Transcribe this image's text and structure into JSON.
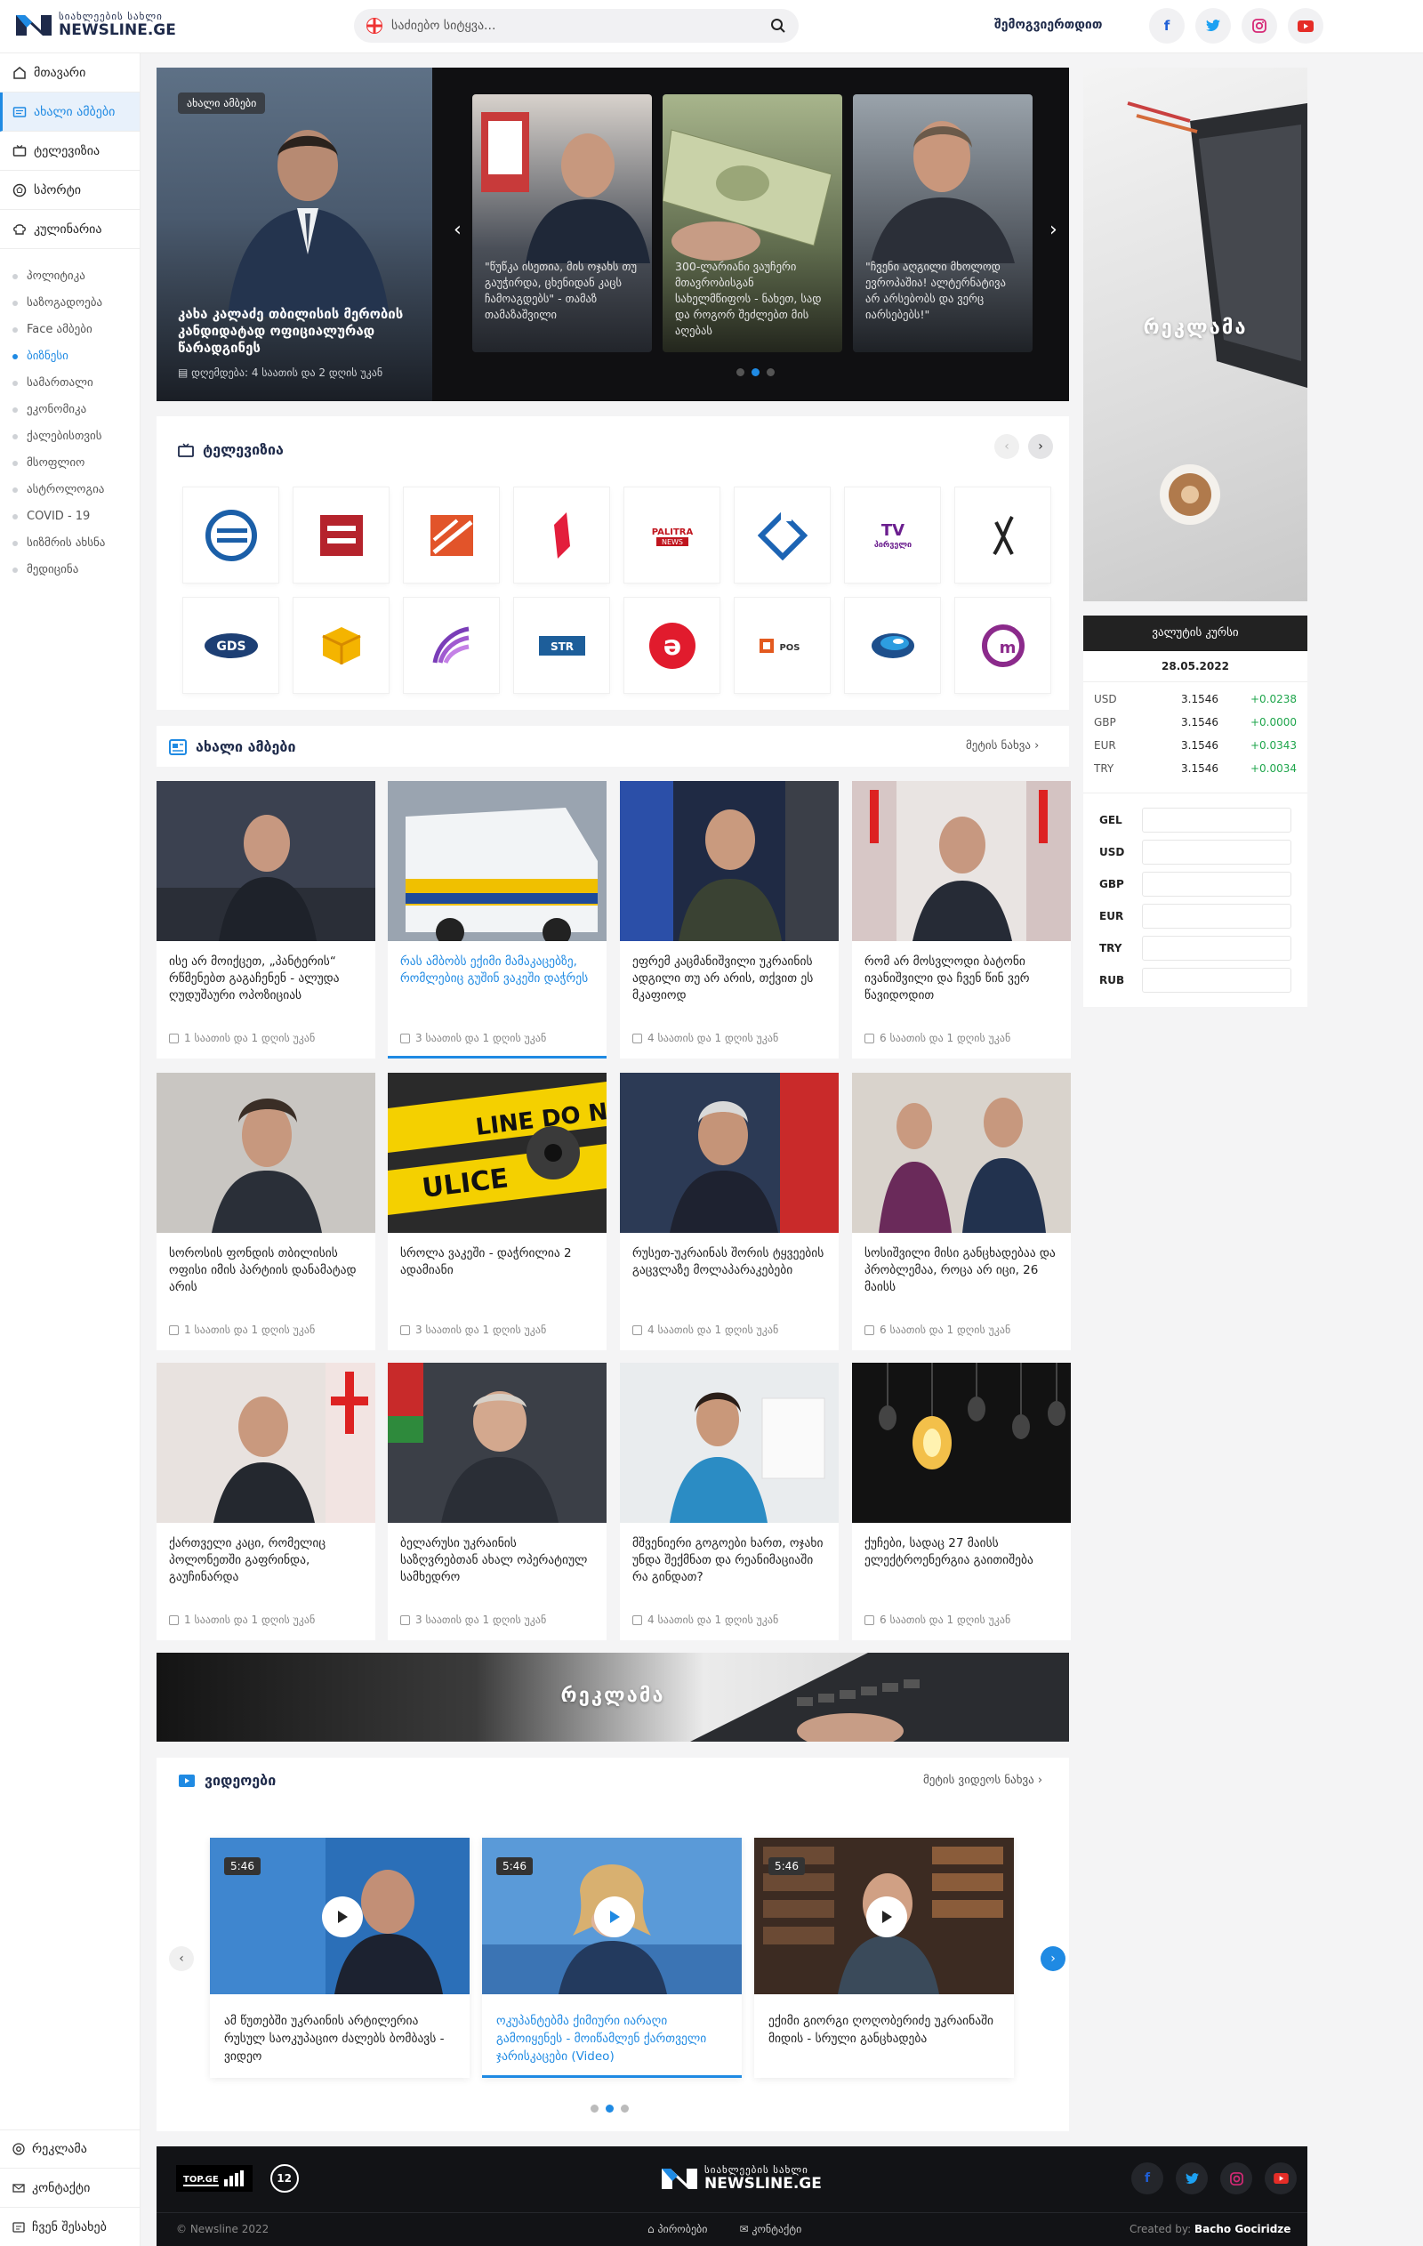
{
  "header": {
    "logo_top": "სიახლეების სახლი",
    "logo_bottom": "NEWSLINE.GE",
    "search_placeholder": "საძიებო სიტყვა...",
    "login": "შემოგვიერთდით"
  },
  "sidebar": {
    "items": [
      {
        "label": "მთავარი"
      },
      {
        "label": "ახალი ამბები"
      },
      {
        "label": "ტელევიზია"
      },
      {
        "label": "სპორტი"
      },
      {
        "label": "კულინარია"
      }
    ],
    "subs": [
      "პოლიტიკა",
      "საზოგადოება",
      "Face ამბები",
      "ბიზნესი",
      "სამართალი",
      "ეკონომიკა",
      "ქალებისთვის",
      "მსოფლიო",
      "ასტროლოგია",
      "COVID - 19",
      "სიზმრის ახსნა",
      "მედიცინა"
    ],
    "bottom": [
      {
        "label": "რეკლამა"
      },
      {
        "label": "კონტაქტი"
      },
      {
        "label": "ჩვენ შესახებ"
      }
    ]
  },
  "hero": {
    "tag": "ახალი ამბები",
    "title": "კახა კალაძე თბილისის მერობის კანდიდატად ოფიციალურად წარადგინეს",
    "time": "დღემდება: 4 საათის და 2 დღის უკან",
    "slides": [
      {
        "caption": "\"წუწკა ისეთია, მის ოჯახს თუ გაუჭირდა, ცხენიდან კაცს ჩამოაგდებს\" - თამაზ თამაზაშვილი"
      },
      {
        "caption": "300-ლარიანი ვაუჩერი მთავრობისგან სახელმწიფოს - ნახეთ, სად და როგორ შეძლებთ მის აღებას"
      },
      {
        "caption": "\"ჩვენი აღგილი მხოლოდ ევროპაშია! ალტერნატივა არ არსებობს და ვერც იარსებებს!\""
      }
    ]
  },
  "ads": {
    "side": "რეკლამა",
    "banner": "რეკლამა"
  },
  "currency": {
    "title": "ვალუტის კურსი",
    "date": "28.05.2022",
    "rates": [
      {
        "code": "USD",
        "value": "3.1546",
        "change": "+0.0238"
      },
      {
        "code": "GBP",
        "value": "3.1546",
        "change": "+0.0000"
      },
      {
        "code": "EUR",
        "value": "3.1546",
        "change": "+0.0343"
      },
      {
        "code": "TRY",
        "value": "3.1546",
        "change": "+0.0034"
      }
    ],
    "converter": [
      "GEL",
      "USD",
      "GBP",
      "EUR",
      "TRY",
      "RUB"
    ]
  },
  "tv": {
    "title": "ტელევიზია"
  },
  "news": {
    "title": "ახალი ამბები",
    "more": "მეტის ნახვა",
    "items": [
      {
        "title": "ისე არ მოიქცეთ, „პანტერის“ რწმენებთ გაგაჩენენ - ალუდა ღუდუშაური ოპოზიციას",
        "time": "1 საათის და 1 დღის უკან"
      },
      {
        "title": "რას ამბობს ექიმი მამაკაცებზე, რომლებიც გუშინ ვაკეში დაჭრეს",
        "time": "3 საათის და 1 დღის უკან"
      },
      {
        "title": "ეფრემ კაცმანიშვილი უკრაინის ადგილი თუ არ არის, თქვით ეს მკაფიოდ",
        "time": "4 საათის და 1 დღის უკან"
      },
      {
        "title": "რომ არ მოსვლოდი ბატონი ივანიშვილი და ჩვენ წინ ვერ წავიდოდით",
        "time": "6 საათის და 1 დღის უკან"
      },
      {
        "title": "სოროსის ფონდის თბილისის ოფისი იმის პარტიის დანამატად არის",
        "time": "1 საათის და 1 დღის უკან"
      },
      {
        "title": "სროლა ვაკეში - დაჭრილია 2 ადამიანი",
        "time": "3 საათის და 1 დღის უკან"
      },
      {
        "title": "რუსეთ-უკრაინას შორის ტყვეების გაცვლაზე მოლაპარაკებები",
        "time": "4 საათის და 1 დღის უკან"
      },
      {
        "title": "სოსიშვილი მისი განცხადებაა და პრობლემაა, როცა არ იცი, 26 მაისს",
        "time": "6 საათის და 1 დღის უკან"
      },
      {
        "title": "ქართველი კაცი, რომელიც პოლონეთში გაფრინდა, გაუჩინარდა",
        "time": "1 საათის და 1 დღის უკან"
      },
      {
        "title": "ბელარუსი უკრაინის საზღვრებთან ახალ ოპერატიულ სამხედრო",
        "time": "3 საათის და 1 დღის უკან"
      },
      {
        "title": "მშვენიერი გოგოები ხართ, ოჯახი უნდა შექმნათ და რეანიმაციაში რა გინდათ?",
        "time": "4 საათის და 1 დღის უკან"
      },
      {
        "title": "ქუჩები, სადაც 27 მაისს ელექტროენერგია გაითიშება",
        "time": "6 საათის და 1 დღის უკან"
      }
    ]
  },
  "videos": {
    "title": "ვიდეოები",
    "more": "მეტის ვიდეოს ნახვა",
    "items": [
      {
        "duration": "5:46",
        "title": "ამ წუთებში უკრაინის არტილერია რუსულ საოკუპაციო ძალებს ბომბავს - ვიდეო"
      },
      {
        "duration": "5:46",
        "title": "ოკუპანტებმა ქიმიური იარაღი გამოიყენეს - მოიწამლენ ქართველი ჯარისკაცები (Video)"
      },
      {
        "duration": "5:46",
        "title": "ექიმი გიორგი ღოღობერიძე უკრაინაში მიდის - სრული განცხადება"
      }
    ]
  },
  "footer": {
    "topge": "TOP.GE",
    "counter": "12",
    "logo_top": "სიახლეების სახლი",
    "logo_bottom": "NEWSLINE.GE",
    "copyright": "© Newsline 2022",
    "links": [
      "პირობები",
      "კონტაქტი"
    ],
    "created_prefix": "Created by:",
    "author": "Bacho Gociridze"
  }
}
